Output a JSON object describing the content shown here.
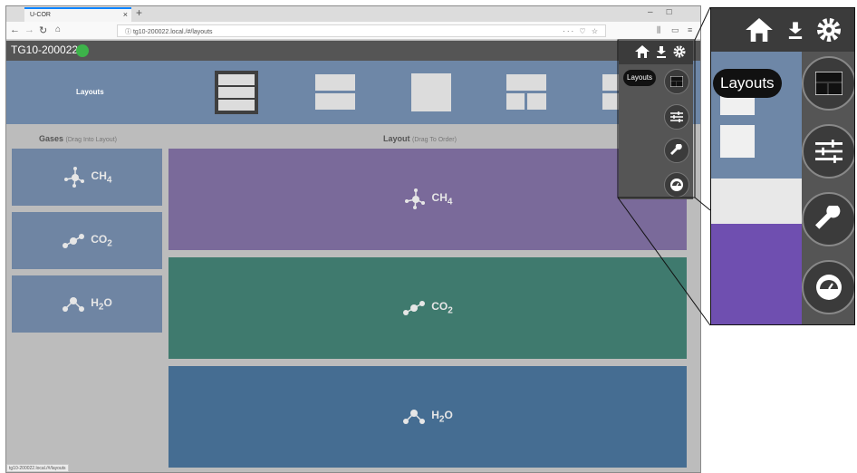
{
  "browser": {
    "tab_title": "U-COR",
    "tab_close": "×",
    "new_tab": "+",
    "url": "tg10-200022.local./#/layouts",
    "url_extras": "··· ♡ ☆",
    "status_url": "tg10-200022.local./#/layouts"
  },
  "app": {
    "device_name": "TG10-200022",
    "status_color": "#3db34a",
    "banner_title": "Layouts"
  },
  "gases": {
    "title": "Gases",
    "subtitle": "(Drag Into Layout)",
    "items": [
      {
        "formula": "CH",
        "sub": "4",
        "icon": "methane-molecule-icon"
      },
      {
        "formula": "CO",
        "sub": "2",
        "icon": "co2-molecule-icon"
      },
      {
        "formula": "H",
        "sub": "2",
        "suffix": "O",
        "icon": "water-molecule-icon"
      }
    ]
  },
  "layout": {
    "title": "Layout",
    "subtitle": "(Drag To Order)",
    "panels": [
      {
        "formula": "CH",
        "sub": "4",
        "suffix": "",
        "color": "#7a6a9a"
      },
      {
        "formula": "CO",
        "sub": "2",
        "suffix": "",
        "color": "#3f7a6e"
      },
      {
        "formula": "H",
        "sub": "2",
        "suffix": "O",
        "color": "#456d92"
      }
    ]
  },
  "menu": {
    "tooltip": "Layouts",
    "icons": [
      "home-icon",
      "download-icon",
      "gear-icon",
      "layouts-icon",
      "sliders-icon",
      "wrench-icon",
      "gauge-icon"
    ]
  },
  "zoom": {
    "tooltip": "Layouts"
  }
}
